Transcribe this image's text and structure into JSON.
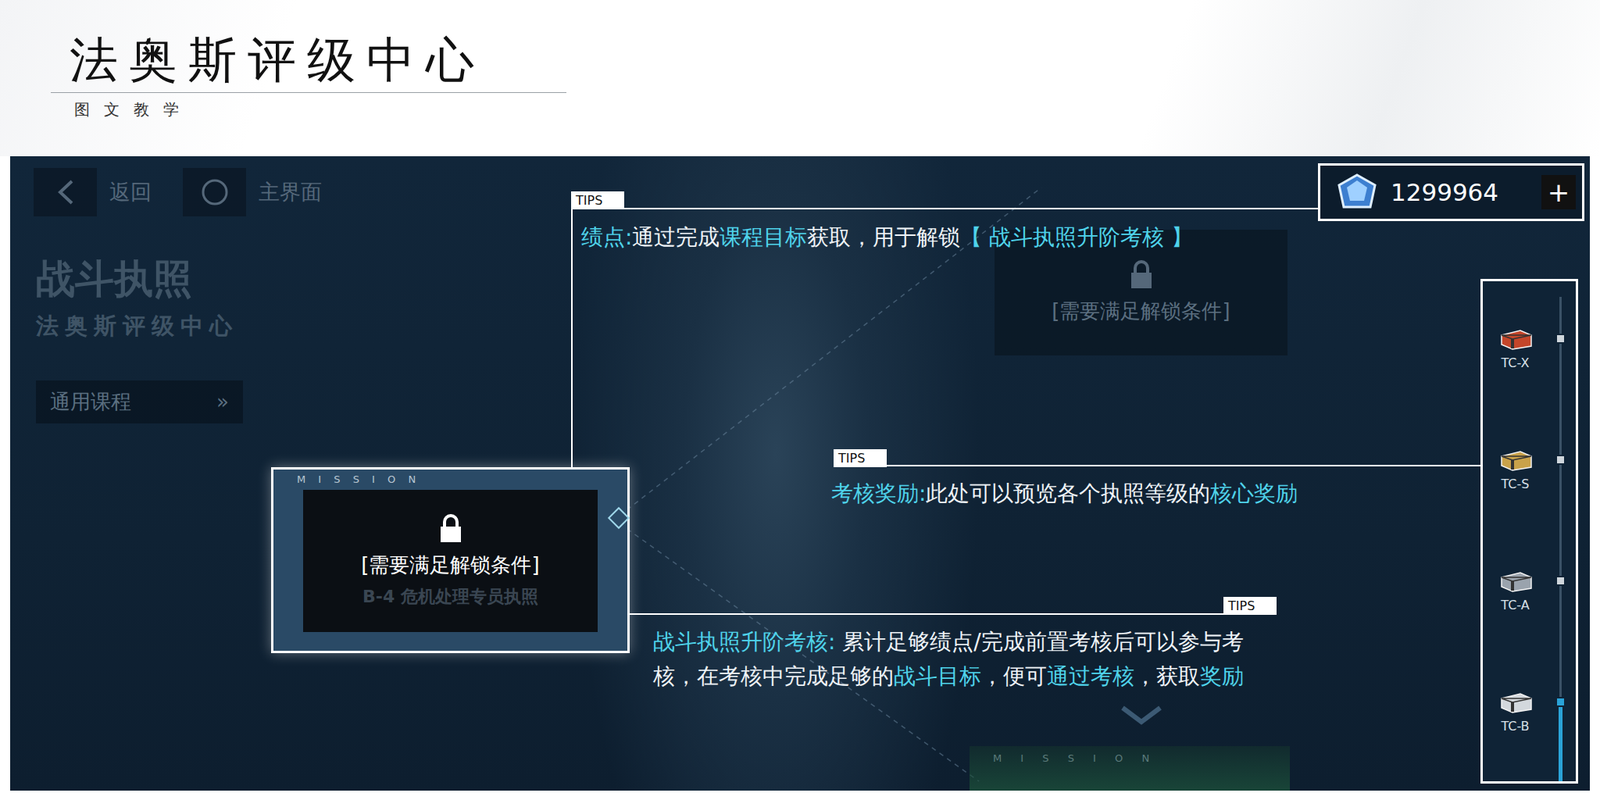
{
  "header": {
    "title": "法奥斯评级中心",
    "subtitle": "图文教学"
  },
  "game": {
    "nav": [
      {
        "label": "返回"
      },
      {
        "label": "主界面"
      }
    ],
    "page_title": "战斗执照",
    "page_subtitle": "法奥斯评级中心",
    "course_button": {
      "label": "通用课程",
      "arrow": "»"
    },
    "currency": {
      "amount": "1299964",
      "add": "+"
    },
    "locked_card": {
      "text": "[需要满足解锁条件]"
    },
    "mission_card": {
      "header": "M I S S I O N",
      "text": "[需要满足解锁条件]",
      "background_text": "B-4 危机处理专员执照"
    },
    "bottom_card": {
      "header": "M I S S I O N"
    },
    "tiers": [
      {
        "label": "TC-X",
        "selected": false,
        "color": "#c4462a"
      },
      {
        "label": "TC-S",
        "selected": false,
        "color": "#c9a24a"
      },
      {
        "label": "TC-A",
        "selected": false,
        "color": "#9aa3ad"
      },
      {
        "label": "TC-B",
        "selected": true,
        "color": "#d3d8dd"
      }
    ]
  },
  "tips": [
    {
      "label": "TIPS",
      "segments": [
        {
          "text": "绩点:",
          "kind": "term"
        },
        {
          "text": "通过完成",
          "kind": "plain"
        },
        {
          "text": "课程目标",
          "kind": "term"
        },
        {
          "text": "获取，用于解锁",
          "kind": "plain"
        },
        {
          "text": "【 战斗执照升阶考核 】",
          "kind": "term"
        }
      ]
    },
    {
      "label": "TIPS",
      "segments": [
        {
          "text": "考核奖励:",
          "kind": "term"
        },
        {
          "text": "此处可以预览各个执照等级的",
          "kind": "plain"
        },
        {
          "text": "核心奖励",
          "kind": "term"
        }
      ]
    },
    {
      "label": "TIPS",
      "segments": [
        {
          "text": "战斗执照升阶考核: ",
          "kind": "term"
        },
        {
          "text": "累计足够绩点/完成前置考核后可以参与考核，在考核中完成足够的",
          "kind": "plain"
        },
        {
          "text": "战斗目标",
          "kind": "term"
        },
        {
          "text": "，便可",
          "kind": "plain"
        },
        {
          "text": "通过考核",
          "kind": "term"
        },
        {
          "text": "，获取",
          "kind": "plain"
        },
        {
          "text": "奖励",
          "kind": "term"
        }
      ]
    }
  ]
}
